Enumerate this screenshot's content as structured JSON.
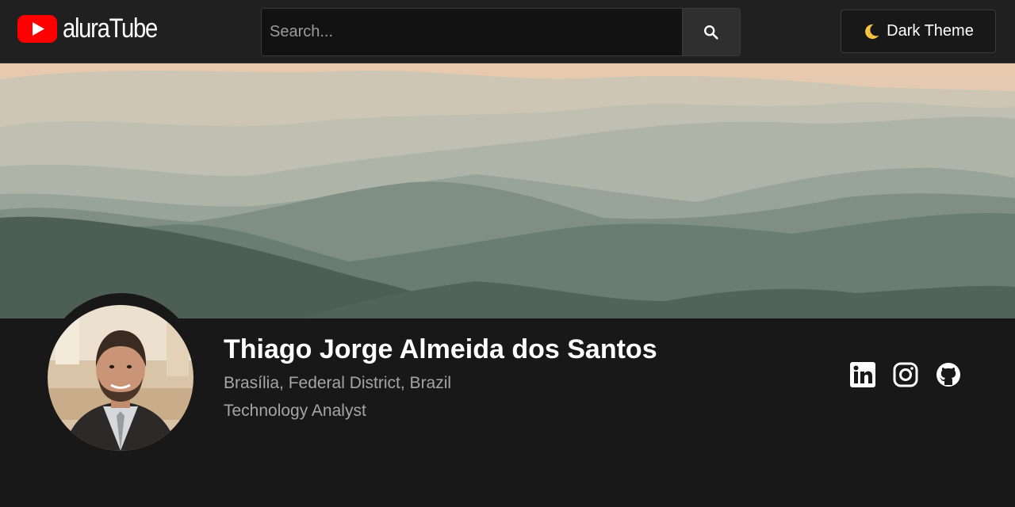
{
  "header": {
    "logo_text": "aluraTube",
    "search": {
      "placeholder": "Search...",
      "value": "",
      "button_icon": "search-icon"
    },
    "theme_toggle": {
      "label": "Dark Theme",
      "icon": "moon-icon"
    }
  },
  "banner": {
    "description_icon": "mountain-landscape"
  },
  "profile": {
    "name": "Thiago Jorge Almeida dos Santos",
    "location": "Brasília, Federal District, Brazil",
    "job": "Technology Analyst",
    "socials": [
      {
        "name": "linkedin",
        "icon": "linkedin-icon"
      },
      {
        "name": "instagram",
        "icon": "instagram-icon"
      },
      {
        "name": "github",
        "icon": "github-icon"
      }
    ]
  },
  "colors": {
    "background": "#181818",
    "header_bg": "#202020",
    "brand_red": "#ff0000",
    "muted_text": "#a5a5a5"
  }
}
